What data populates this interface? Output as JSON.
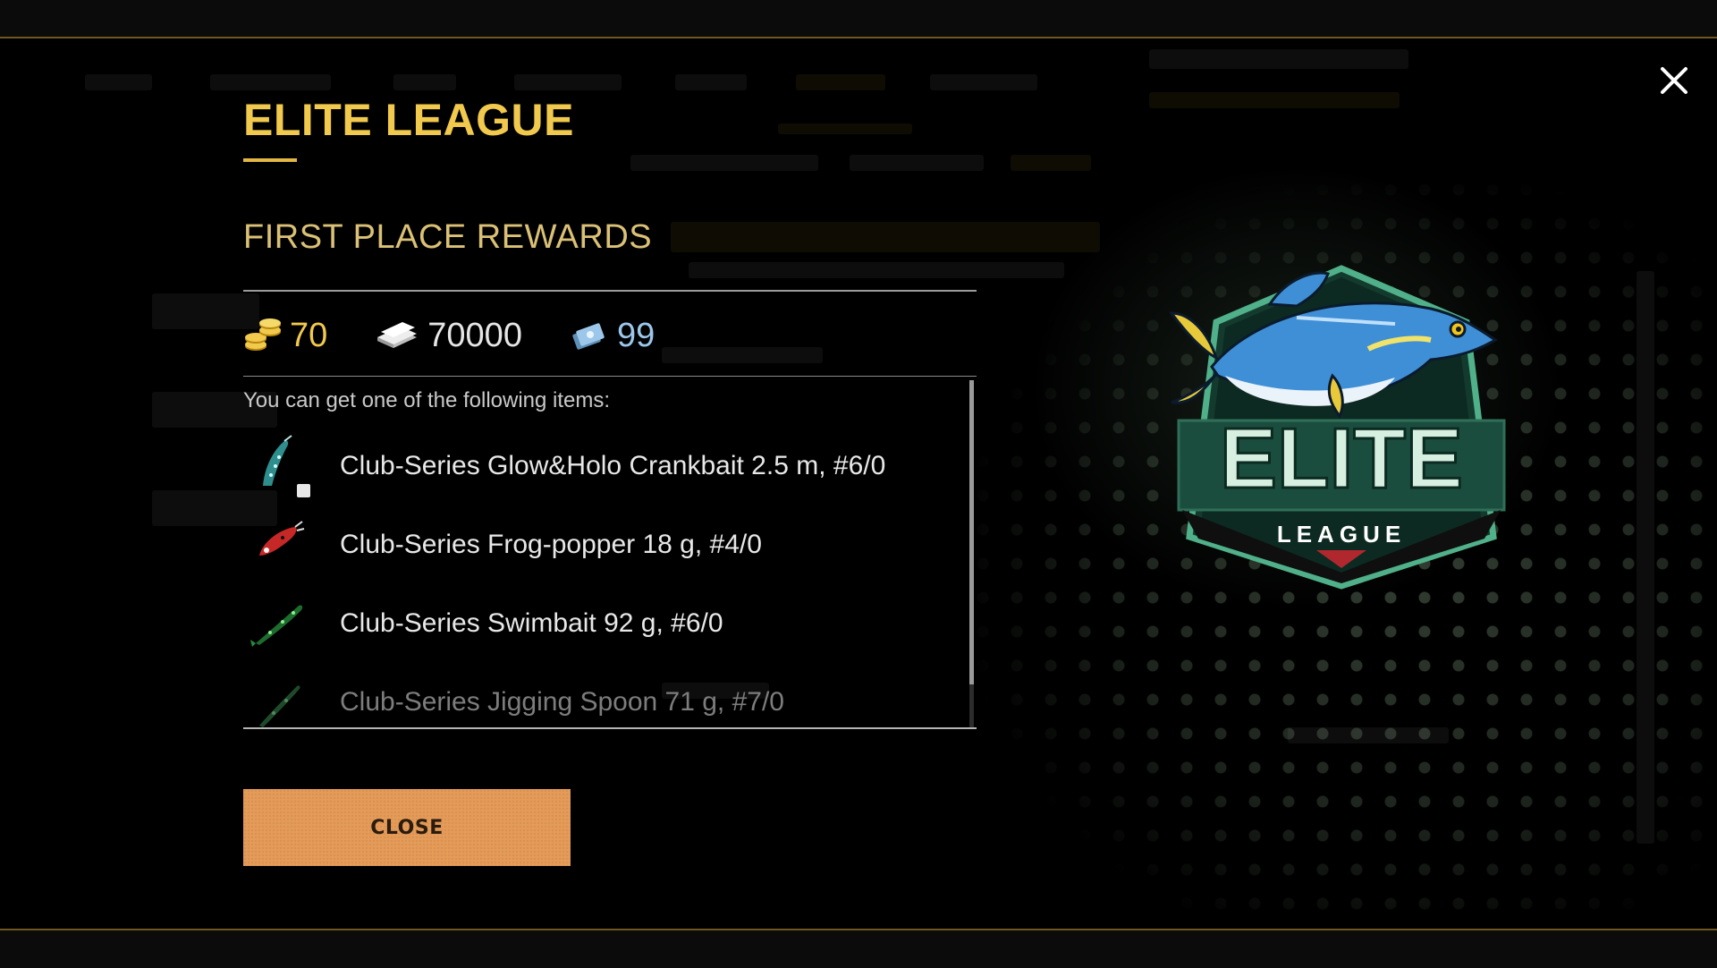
{
  "dialog": {
    "title": "ELITE LEAGUE",
    "subtitle": "FIRST PLACE REWARDS",
    "currencies": [
      {
        "icon": "gold-coins-icon",
        "value": "70",
        "color": "#f0c94d"
      },
      {
        "icon": "silver-cash-icon",
        "value": "70000",
        "color": "#e6e6e6"
      },
      {
        "icon": "baitcoin-tickets-icon",
        "value": "99",
        "color": "#9cc7ea"
      }
    ],
    "hint": "You can get one of the following items:",
    "items": [
      {
        "name": "Club-Series Glow&Holo Crankbait 2.5 m, #6/0",
        "icon": "crankbait-lure-icon"
      },
      {
        "name": "Club-Series Frog-popper 18 g, #4/0",
        "icon": "frog-popper-lure-icon"
      },
      {
        "name": "Club-Series Swimbait 92 g, #6/0",
        "icon": "swimbait-lure-icon"
      },
      {
        "name": "Club-Series Jigging Spoon 71 g, #7/0",
        "icon": "jigging-spoon-lure-icon"
      }
    ],
    "close_label": "CLOSE"
  },
  "logo": {
    "word": "ELITE",
    "subword": "LEAGUE"
  },
  "colors": {
    "accent_gold": "#f0c94d",
    "button": "#e69b58",
    "logo_green": "#1b4d3e"
  }
}
